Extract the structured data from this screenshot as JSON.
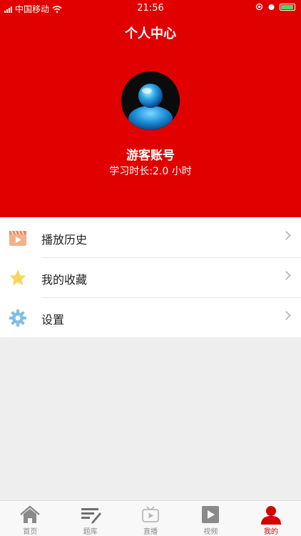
{
  "status_bar": {
    "carrier": "中国移动",
    "time": "21:56"
  },
  "header": {
    "title": "个人中心",
    "username": "游客账号",
    "study_time": "学习时长:2.0 小时"
  },
  "menu": {
    "items": [
      {
        "label": "播放历史",
        "icon": "play-history-icon"
      },
      {
        "label": "我的收藏",
        "icon": "star-icon"
      },
      {
        "label": "设置",
        "icon": "gear-icon"
      }
    ]
  },
  "tab_bar": {
    "items": [
      {
        "label": "首页",
        "icon": "home-icon"
      },
      {
        "label": "题库",
        "icon": "question-bank-icon"
      },
      {
        "label": "直播",
        "icon": "tv-icon"
      },
      {
        "label": "视频",
        "icon": "video-play-icon"
      },
      {
        "label": "我的",
        "icon": "user-icon",
        "active": true
      }
    ]
  },
  "colors": {
    "primary_red": "#e00000",
    "active_tab": "#d40000",
    "background": "#eeeeee"
  }
}
